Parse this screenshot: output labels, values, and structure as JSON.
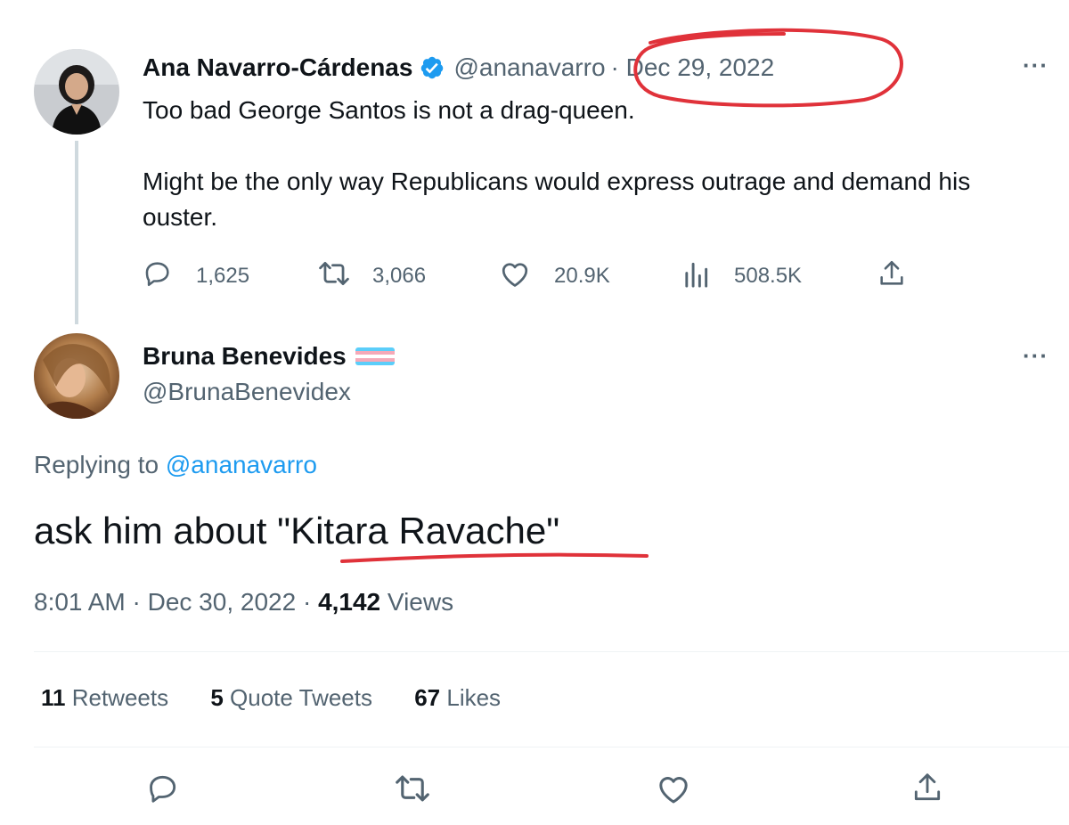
{
  "original_tweet": {
    "author_name": "Ana Navarro-Cárdenas",
    "handle": "@ananavarro",
    "date": "· Dec 29, 2022",
    "text": "Too bad George Santos is not a drag-queen.\n\nMight be the only way Republicans would express outrage and demand his ouster.",
    "replies": "1,625",
    "retweets": "3,066",
    "likes": "20.9K",
    "views": "508.5K",
    "more_glyph": "···"
  },
  "reply_tweet": {
    "author_name": "Bruna Benevides",
    "handle": "@BrunaBenevidex",
    "replying_prefix": "Replying to ",
    "replying_to": "@ananavarro",
    "text_prefix": "ask him about \"",
    "text_highlight": "Kitara Ravache",
    "text_suffix": "\"",
    "time": "8:01 AM · Dec 30, 2022 · ",
    "views_count": "4,142",
    "views_label": " Views",
    "more_glyph": "···"
  },
  "stats": {
    "retweets_count": "11",
    "retweets_label": " Retweets",
    "quotes_count": "5",
    "quotes_label": " Quote Tweets",
    "likes_count": "67",
    "likes_label": " Likes"
  },
  "colors": {
    "link": "#1d9bf0",
    "secondary": "#536471",
    "annotation": "#e0323a",
    "verified": "#1d9bf0"
  },
  "icons": [
    "verified-badge-icon",
    "reply-icon",
    "retweet-icon",
    "like-icon",
    "views-icon",
    "share-icon",
    "more-icon",
    "trans-flag-icon"
  ]
}
